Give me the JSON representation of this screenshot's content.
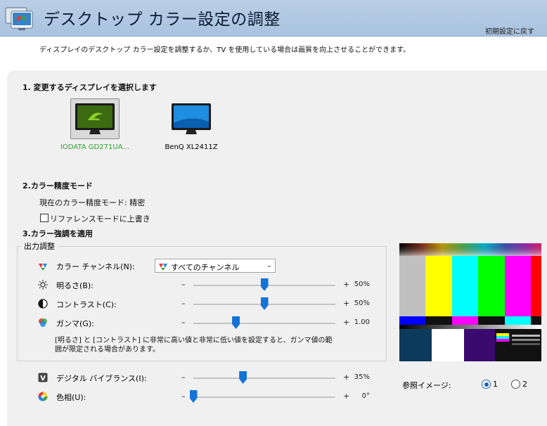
{
  "header": {
    "title": "デスクトップ カラー設定の調整",
    "restore_link": "初期設定に戻す"
  },
  "intro": "ディスプレイのデスクトップ カラー設定を調整するか、TV を使用している場合は画質を向上させることができます。",
  "section1": {
    "title": "1. 変更するディスプレイを選択します",
    "displays": [
      {
        "label": "IODATA GD271UA...",
        "selected": true
      },
      {
        "label": "BenQ XL2411Z",
        "selected": false
      }
    ]
  },
  "section2": {
    "title": "2.カラー精度モード",
    "current_mode": "現在のカラー精度モード: 精密",
    "override_checkbox_label": "リファレンスモードに上書き",
    "override_checked": false
  },
  "section3": {
    "title": "3.カラー強調を適用",
    "group_title": "出力調整",
    "channel_label": "カラー チャンネル(N):",
    "channel_value": "すべてのチャンネル",
    "sliders": [
      {
        "label": "明るさ(B):",
        "value_text": "50%",
        "level": 0.5,
        "icon": "brightness-icon"
      },
      {
        "label": "コントラスト(C):",
        "value_text": "50%",
        "level": 0.5,
        "icon": "contrast-icon"
      },
      {
        "label": "ガンマ(G):",
        "value_text": "1.00",
        "level": 0.3,
        "icon": "gamma-icon"
      }
    ],
    "warning": "[明るさ] と [コントラスト] に非常に高い値と非常に低い値を設定すると、ガンマ値の範囲が限定される場合があります。",
    "vibrance": {
      "label": "デジタル バイブランス(I):",
      "value_text": "35%",
      "level": 0.35
    },
    "hue": {
      "label": "色相(U):",
      "value_text": "0°",
      "level": 0.0
    },
    "minus": "–",
    "plus": "+"
  },
  "reference": {
    "label": "参照イメージ:",
    "options": [
      "1",
      "2"
    ],
    "selected": "1"
  },
  "colors": {
    "header_bg": "#b9cfe6",
    "panel_bg": "#f0f0f0",
    "accent_blue": "#1473d6",
    "selected_green": "#31a331"
  }
}
